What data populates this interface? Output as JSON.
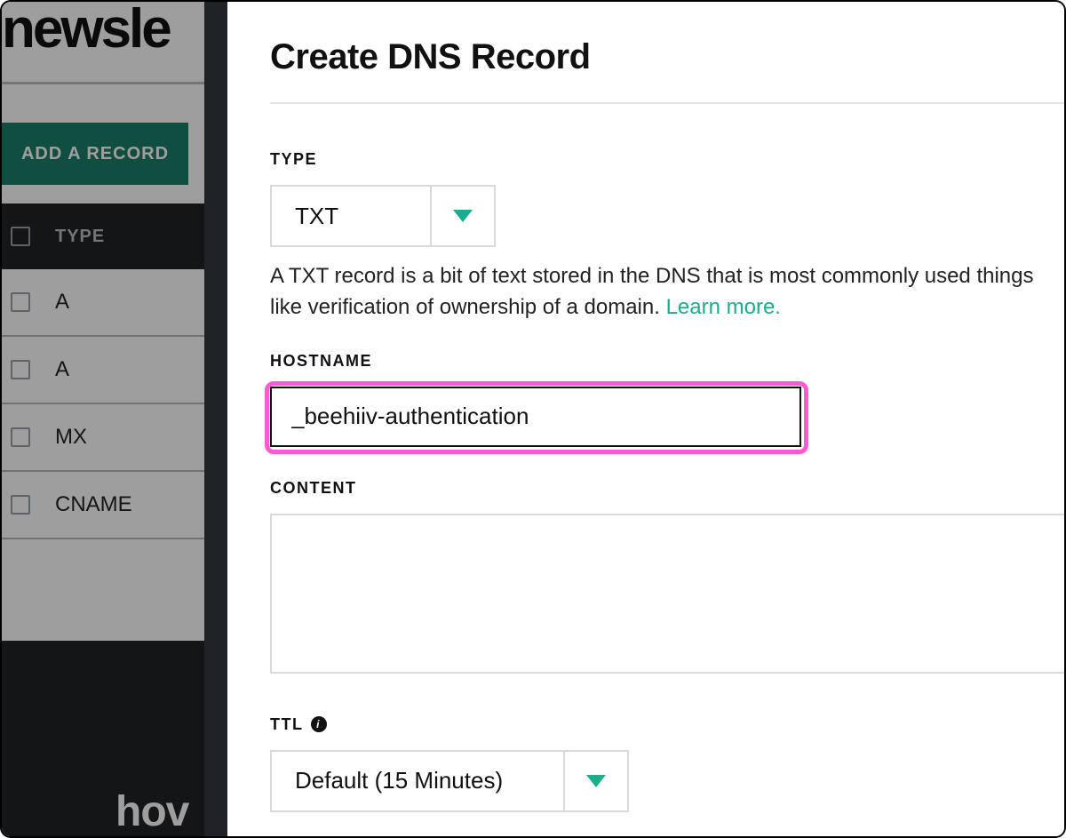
{
  "backdrop": {
    "brand_fragment": "newsle",
    "add_record_button": "ADD A RECORD",
    "table": {
      "header": "TYPE",
      "rows": [
        "A",
        "A",
        "MX",
        "CNAME"
      ]
    },
    "bottom_brand_fragment": "hov"
  },
  "panel": {
    "title": "Create DNS Record",
    "type": {
      "label": "TYPE",
      "value": "TXT",
      "help_text_prefix": "A TXT record is a bit of text stored in the DNS that is most commonly used things like verification of ownership of a domain. ",
      "learn_more": "Learn more."
    },
    "hostname": {
      "label": "HOSTNAME",
      "value": "_beehiiv-authentication"
    },
    "content": {
      "label": "CONTENT",
      "value": ""
    },
    "ttl": {
      "label": "TTL",
      "value": "Default (15 Minutes)"
    }
  }
}
